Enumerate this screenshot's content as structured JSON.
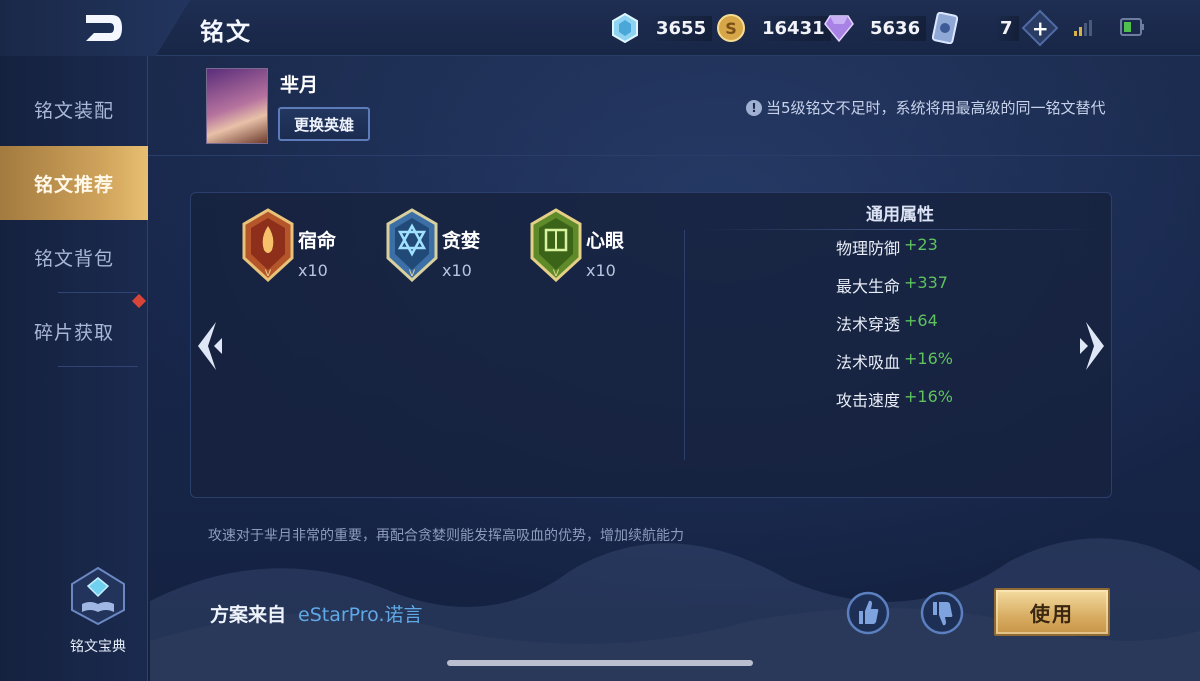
{
  "colors": {
    "accent_gold": "#d0a45c",
    "stat_green": "#5ec25e",
    "author_blue": "#5fa9e6",
    "background": "#16223f"
  },
  "header": {
    "title": "铭文",
    "back_icon": "back-arrow-icon",
    "currencies": [
      {
        "icon": "diamond-icon",
        "value": "3655"
      },
      {
        "icon": "gold-coin-icon",
        "value": "16431"
      },
      {
        "icon": "gem-icon",
        "value": "5636"
      },
      {
        "icon": "card-icon",
        "value": "7"
      }
    ]
  },
  "sidebar": {
    "items": [
      {
        "label": "铭文装配",
        "active": false
      },
      {
        "label": "铭文推荐",
        "active": true
      },
      {
        "label": "铭文背包",
        "active": false
      },
      {
        "label": "碎片获取",
        "active": false
      }
    ],
    "codex_label": "铭文宝典"
  },
  "hero": {
    "name": "芈月",
    "swap_label": "更换英雄"
  },
  "notice": "当5级铭文不足时，系统将用最高级的同一铭文替代",
  "runes": [
    {
      "name": "宿命",
      "count": "x10",
      "color": "red",
      "level": "V"
    },
    {
      "name": "贪婪",
      "count": "x10",
      "color": "blue",
      "level": "V"
    },
    {
      "name": "心眼",
      "count": "x10",
      "color": "green",
      "level": "V"
    }
  ],
  "attributes": {
    "title": "通用属性",
    "rows": [
      {
        "name": "物理防御",
        "value": "+23"
      },
      {
        "name": "最大生命",
        "value": "+337"
      },
      {
        "name": "法术穿透",
        "value": "+64"
      },
      {
        "name": "法术吸血",
        "value": "+16%"
      },
      {
        "name": "攻击速度",
        "value": "+16%"
      }
    ]
  },
  "description": "攻速对于芈月非常的重要，再配合贪婪则能发挥高吸血的优势，增加续航能力",
  "source": {
    "label": "方案来自",
    "author": "eStarPro.诺言"
  },
  "actions": {
    "use_label": "使用"
  }
}
